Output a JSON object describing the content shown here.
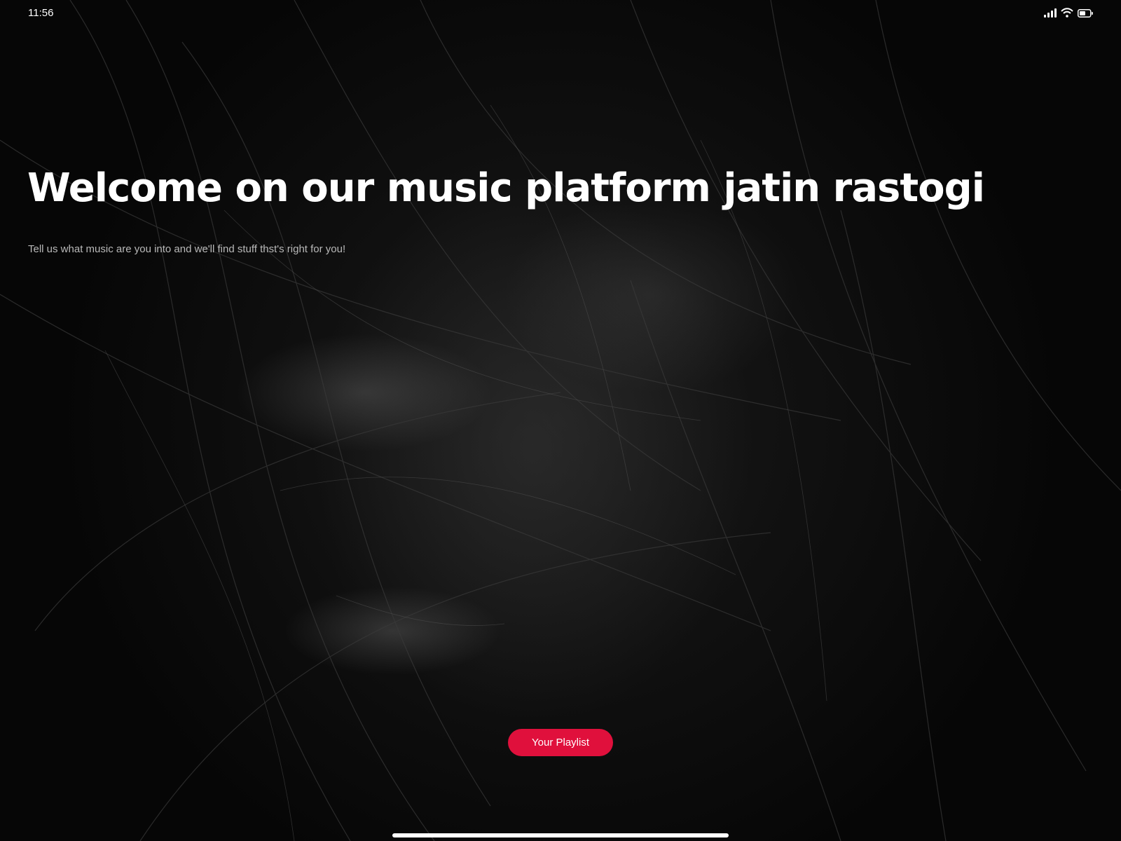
{
  "status_bar": {
    "time": "11:56",
    "icons": [
      "signal-icon",
      "wifi-icon",
      "battery-icon"
    ]
  },
  "hero": {
    "title": "Welcome on our music platform jatin rastogi",
    "subtitle": "Tell us what music are you into and we'll find stuff thst's right for you!",
    "cta_label": "Your Playlist"
  },
  "colors": {
    "background": "#070707",
    "accent": "#e0103c",
    "text": "#ffffff",
    "subtext": "#b9b9b9"
  }
}
